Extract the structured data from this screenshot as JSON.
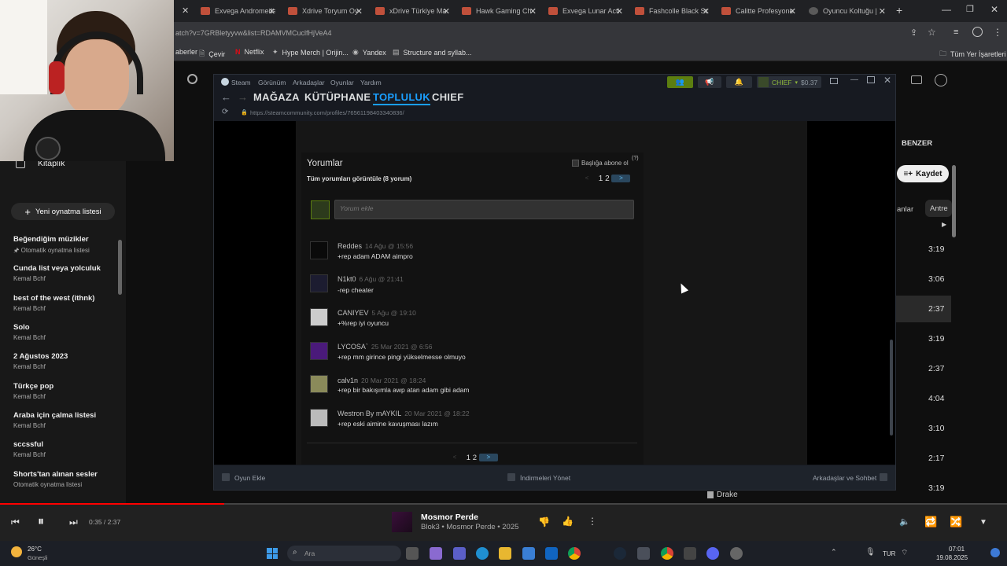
{
  "browser": {
    "tabs": [
      {
        "label": "Exvega Andromeda"
      },
      {
        "label": "Xdrive Toryum Oy"
      },
      {
        "label": "xDrive Türkiye Ma"
      },
      {
        "label": "Hawk Gaming Ch"
      },
      {
        "label": "Exvega Lunar Acti"
      },
      {
        "label": "Fashcolle Black St"
      },
      {
        "label": "Calitte Profesyone"
      },
      {
        "label": "Oyuncu Koltuğu |"
      }
    ],
    "url": "atch?v=7GRBletyyvw&list=RDAMVMCuclfHjVeA4",
    "bookmarks": [
      "aberler",
      "Çevir",
      "Netflix",
      "Hype Merch | Orijin...",
      "Yandex",
      "Structure and syllab...",
      "Tüm Yer İşaretleri"
    ]
  },
  "ytm": {
    "sidebar": {
      "library_label": "Kitaplık",
      "new_playlist": "Yeni oynatma listesi",
      "playlists": [
        {
          "title": "Beğendiğim müzikler",
          "sub": "Otomatik oynatma listesi"
        },
        {
          "title": "Cunda list veya yolculuk",
          "sub": "Kemal Bchf"
        },
        {
          "title": "best of the west (ithnk)",
          "sub": "Kemal Bchf"
        },
        {
          "title": "Solo",
          "sub": "Kemal Bchf"
        },
        {
          "title": "2 Ağustos 2023",
          "sub": "Kemal Bchf"
        },
        {
          "title": "Türkçe pop",
          "sub": "Kemal Bchf"
        },
        {
          "title": "Araba için çalma listesi",
          "sub": "Kemal Bchf"
        },
        {
          "title": "sccssful",
          "sub": "Kemal Bchf"
        },
        {
          "title": "Shorts'tan alınan sesler",
          "sub": "Otomatik oynatma listesi"
        }
      ]
    },
    "right": {
      "benzer": "BENZER",
      "save": "Kaydet",
      "chip1": "anlar",
      "chip2": "Antre",
      "durations": [
        "3:19",
        "3:06",
        "2:37",
        "3:19",
        "2:37",
        "4:04",
        "3:10",
        "2:17",
        "3:19"
      ],
      "drake": "Drake"
    },
    "player": {
      "time": "0:35 / 2:37",
      "progress_fraction": 0.2229,
      "song_title": "Mosmor Perde",
      "song_meta": "Blok3 • Mosmor Perde • 2025"
    }
  },
  "steam": {
    "menu": [
      "Steam",
      "Görünüm",
      "Arkadaşlar",
      "Oyunlar",
      "Yardım"
    ],
    "nav": [
      "MAĞAZA",
      "KÜTÜPHANE",
      "TOPLULUK",
      "CHIEF"
    ],
    "url": "https://steamcommunity.com/profiles/76561198403340836/",
    "user": "CHIEF",
    "balance": "$0.37",
    "comments_title": "Yorumlar",
    "subscribe_label": "Başlığa abone ol",
    "subscribe_hint": "(?)",
    "view_all": "Tüm yorumları görüntüle (8 yorum)",
    "placeholder": "Yorum ekle",
    "pages": "1 2",
    "comments": [
      {
        "author": "Reddes",
        "date": "14 Ağu @ 15:56",
        "text": "+rep adam ADAM aimpro"
      },
      {
        "author": "N1kt0",
        "date": "6 Ağu @ 21:41",
        "text": "-rep cheater"
      },
      {
        "author": "CANIYEV",
        "date": "5 Ağu @ 19:10",
        "text": "+%rep iyi oyuncu"
      },
      {
        "author": "LYCOSA`",
        "date": "25 Mar 2021 @ 6:56",
        "text": "+rep mm girince pingi yükselmesse olmuyo"
      },
      {
        "author": "calv1n",
        "date": "20 Mar 2021 @ 18:24",
        "text": "+rep bir bakışımla awp atan adam gibi adam"
      },
      {
        "author": "Westron By mAYKIL",
        "date": "20 Mar 2021 @ 18:22",
        "text": "+rep eski aimine kavuşması lazım"
      }
    ],
    "bottom": {
      "add_game": "Oyun Ekle",
      "downloads": "İndirmeleri Yönet",
      "friends": "Arkadaşlar ve Sohbet"
    }
  },
  "taskbar": {
    "weather_temp": "26°C",
    "weather_desc": "Güneşli",
    "search": "Ara",
    "lang": "TUR",
    "time": "07:01",
    "date": "19.08.2025"
  },
  "colors": {
    "steam_accent": "#1a9fff",
    "steam_friends_green": "#5c7e10",
    "ytm_red": "#ff0000"
  }
}
